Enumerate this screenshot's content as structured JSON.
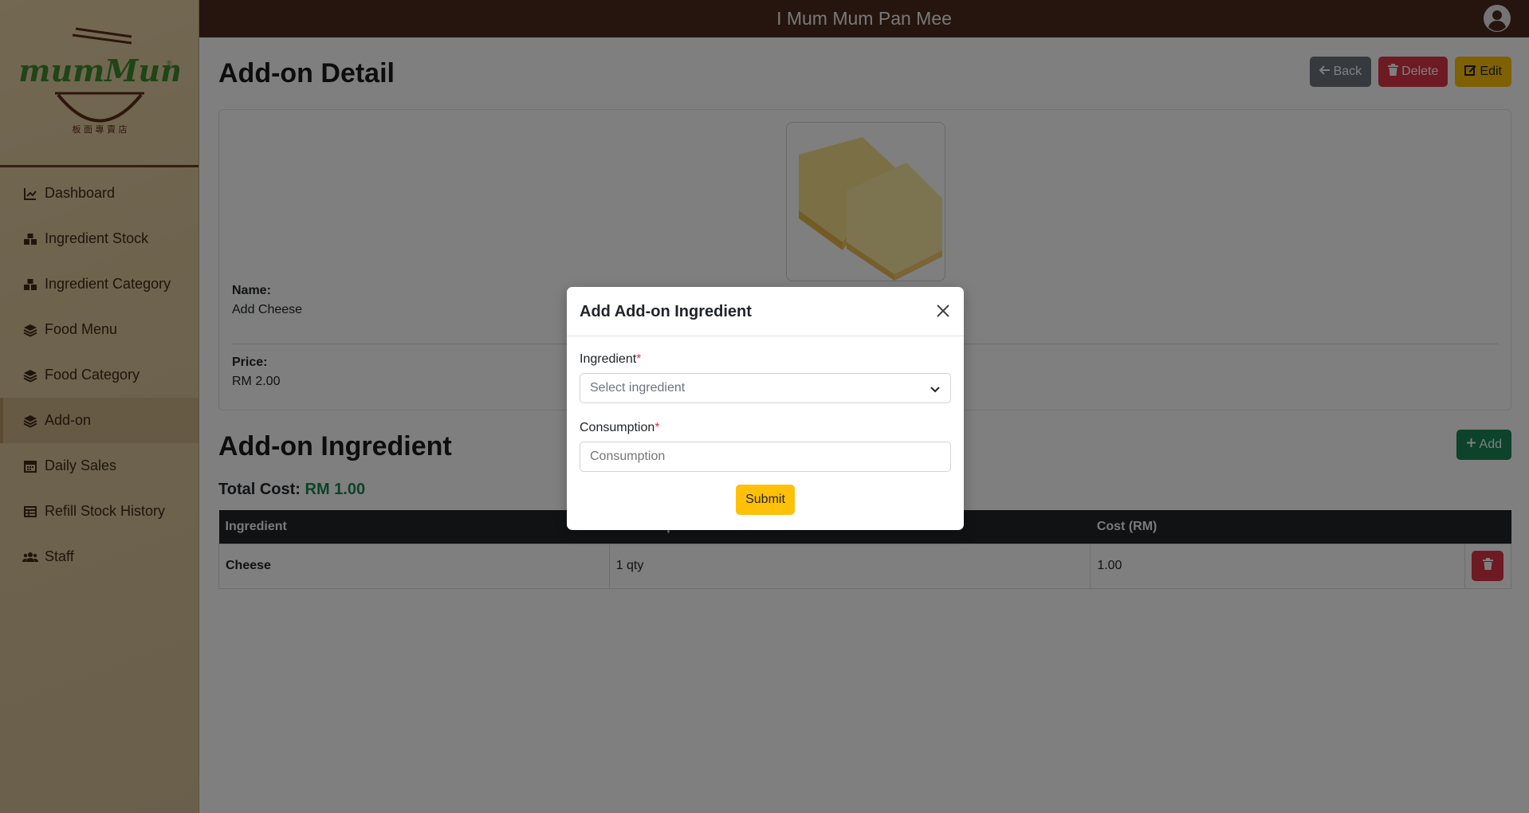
{
  "app": {
    "title": "I Mum Mum Pan Mee"
  },
  "sidebar": {
    "logo_text": "imumMum",
    "logo_sub": "板 面 專 賣 店",
    "items": [
      {
        "label": "Dashboard",
        "icon": "chart-line-icon"
      },
      {
        "label": "Ingredient Stock",
        "icon": "boxes-icon"
      },
      {
        "label": "Ingredient Category",
        "icon": "boxes-icon"
      },
      {
        "label": "Food Menu",
        "icon": "layer-icon"
      },
      {
        "label": "Food Category",
        "icon": "layer-icon"
      },
      {
        "label": "Add-on",
        "icon": "layer-icon",
        "active": true
      },
      {
        "label": "Daily Sales",
        "icon": "calendar-icon"
      },
      {
        "label": "Refill Stock History",
        "icon": "table-icon"
      },
      {
        "label": "Staff",
        "icon": "users-icon"
      }
    ]
  },
  "page": {
    "title": "Add-on Detail",
    "buttons": {
      "back": "Back",
      "delete": "Delete",
      "edit": "Edit"
    },
    "detail": {
      "name_label": "Name:",
      "name_value": "Add Cheese",
      "price_label": "Price:",
      "price_value": "RM 2.00"
    },
    "ingredient_section": {
      "title": "Add-on Ingredient",
      "add_label": "Add",
      "total_cost_label": "Total Cost:",
      "total_cost_value": "RM 1.00",
      "columns": [
        "Ingredient",
        "Consumption",
        "Cost (RM)",
        ""
      ],
      "rows": [
        {
          "ingredient": "Cheese",
          "consumption": "1 qty",
          "cost": "1.00"
        }
      ]
    }
  },
  "modal": {
    "title": "Add Add-on Ingredient",
    "ingredient_label": "Ingredient",
    "ingredient_placeholder": "Select ingredient",
    "consumption_label": "Consumption",
    "consumption_placeholder": "Consumption",
    "required_mark": "*",
    "submit_label": "Submit"
  },
  "colors": {
    "topbar": "#4a2b1c",
    "primary_green": "#198754",
    "danger": "#dc3545",
    "warning": "#ffc107",
    "secondary": "#6c757d"
  }
}
